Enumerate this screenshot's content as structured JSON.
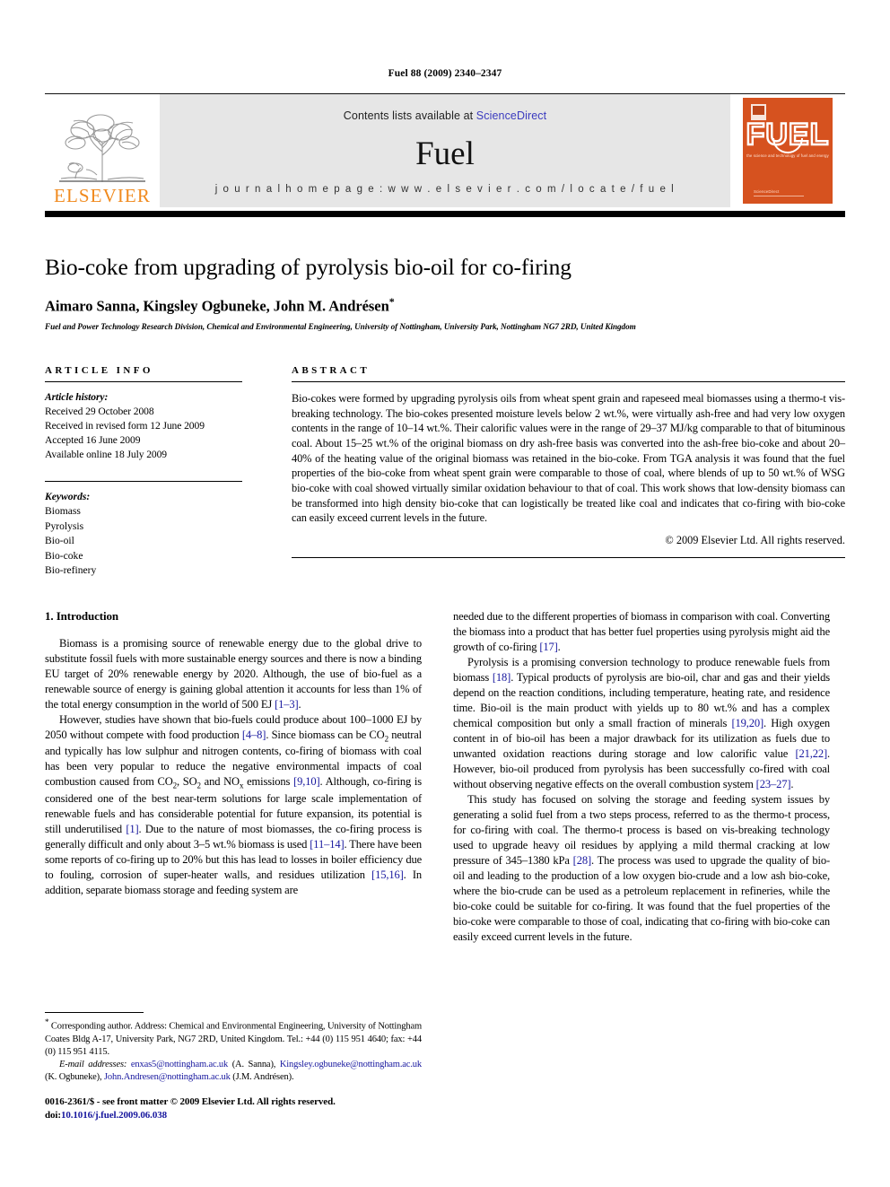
{
  "running_head": "Fuel 88 (2009) 2340–2347",
  "masthead": {
    "publisher_name": "ELSEVIER",
    "contents_prefix": "Contents lists available at ",
    "sciencedirect": "ScienceDirect",
    "journal_name": "Fuel",
    "homepage": "j o u r n a l   h o m e p a g e :   w w w . e l s e v i e r . c o m / l o c a t e / f u e l",
    "cover": {
      "title": "FUEL",
      "subtitle": "the science and technology of fuel and energy",
      "footer": "ScienceDirect"
    }
  },
  "article": {
    "title": "Bio-coke from upgrading of pyrolysis bio-oil for co-firing",
    "authors": "Aimaro Sanna, Kingsley Ogbuneke, John M. Andrésen",
    "author_star": "*",
    "affiliation": "Fuel and Power Technology Research Division, Chemical and Environmental Engineering, University of Nottingham, University Park, Nottingham NG7 2RD, United Kingdom"
  },
  "article_info": {
    "heading": "ARTICLE INFO",
    "history_label": "Article history:",
    "history": [
      "Received 29 October 2008",
      "Received in revised form 12 June 2009",
      "Accepted 16 June 2009",
      "Available online 18 July 2009"
    ],
    "keywords_label": "Keywords:",
    "keywords": [
      "Biomass",
      "Pyrolysis",
      "Bio-oil",
      "Bio-coke",
      "Bio-refinery"
    ]
  },
  "abstract": {
    "heading": "ABSTRACT",
    "text": "Bio-cokes were formed by upgrading pyrolysis oils from wheat spent grain and rapeseed meal biomasses using a thermo-t vis-breaking technology. The bio-cokes presented moisture levels below 2 wt.%, were virtually ash-free and had very low oxygen contents in the range of 10–14 wt.%. Their calorific values were in the range of 29–37 MJ/kg comparable to that of bituminous coal. About 15–25 wt.% of the original biomass on dry ash-free basis was converted into the ash-free bio-coke and about 20–40% of the heating value of the original biomass was retained in the bio-coke. From TGA analysis it was found that the fuel properties of the bio-coke from wheat spent grain were comparable to those of coal, where blends of up to 50 wt.% of WSG bio-coke with coal showed virtually similar oxidation behaviour to that of coal. This work shows that low-density biomass can be transformed into high density bio-coke that can logistically be treated like coal and indicates that co-firing with bio-coke can easily exceed current levels in the future.",
    "copyright": "© 2009 Elsevier Ltd. All rights reserved."
  },
  "introduction": {
    "section_title": "1. Introduction",
    "left_paragraphs": [
      "Biomass is a promising source of renewable energy due to the global drive to substitute fossil fuels with more sustainable energy sources and there is now a binding EU target of 20% renewable energy by 2020. Although, the use of bio-fuel as a renewable source of energy is gaining global attention it accounts for less than 1% of the total energy consumption in the world of 500 EJ [1–3].",
      "However, studies have shown that bio-fuels could produce about 100–1000 EJ by 2050 without compete with food production [4–8]. Since biomass can be CO2 neutral and typically has low sulphur and nitrogen contents, co-firing of biomass with coal has been very popular to reduce the negative environmental impacts of coal combustion caused from CO2, SO2 and NOx emissions [9,10]. Although, co-firing is considered one of the best near-term solutions for large scale implementation of renewable fuels and has considerable potential for future expansion, its potential is still underutilised [1]. Due to the nature of most biomasses, the co-firing process is generally difficult and only about 3–5 wt.% biomass is used [11–14]. There have been some reports of co-firing up to 20% but this has lead to losses in boiler efficiency due to fouling, corrosion of super-heater walls, and residues utilization [15,16]. In addition, separate biomass storage and feeding system are"
    ],
    "right_paragraphs": [
      "needed due to the different properties of biomass in comparison with coal. Converting the biomass into a product that has better fuel properties using pyrolysis might aid the growth of co-firing [17].",
      "Pyrolysis is a promising conversion technology to produce renewable fuels from biomass [18]. Typical products of pyrolysis are bio-oil, char and gas and their yields depend on the reaction conditions, including temperature, heating rate, and residence time. Bio-oil is the main product with yields up to 80 wt.% and has a complex chemical composition but only a small fraction of minerals [19,20]. High oxygen content in of bio-oil has been a major drawback for its utilization as fuels due to unwanted oxidation reactions during storage and low calorific value [21,22]. However, bio-oil produced from pyrolysis has been successfully co-fired with coal without observing negative effects on the overall combustion system [23–27].",
      "This study has focused on solving the storage and feeding system issues by generating a solid fuel from a two steps process, referred to as the thermo-t process, for co-firing with coal. The thermo-t process is based on vis-breaking technology used to upgrade heavy oil residues by applying a mild thermal cracking at low pressure of 345–1380 kPa [28]. The process was used to upgrade the quality of bio-oil and leading to the production of a low oxygen bio-crude and a low ash bio-coke, where the bio-crude can be used as a petroleum replacement in refineries, while the bio-coke could be suitable for co-firing. It was found that the fuel properties of the bio-coke were comparable to those of coal, indicating that co-firing with bio-coke can easily exceed current levels in the future."
    ]
  },
  "footnote": {
    "star": "*",
    "corresponding": " Corresponding author. Address: Chemical and Environmental Engineering, University of Nottingham Coates Bldg A-17, University Park, NG7 2RD, United Kingdom. Tel.: +44 (0) 115 951 4640; fax: +44 (0) 115 951 4115.",
    "email_label": "E-mail addresses:",
    "email1": "enxas5@nottingham.ac.uk",
    "email1_name": " (A. Sanna), ",
    "email2": "Kingsley.ogbuneke@nottingham.ac.uk",
    "email2_name": " (K. Ogbuneke), ",
    "email3": "John.Andresen@nottingham.ac.uk",
    "email3_name": " (J.M. Andrésen)."
  },
  "imprint": {
    "front_matter": "0016-2361/$ - see front matter © 2009 Elsevier Ltd. All rights reserved.",
    "doi_label": "doi:",
    "doi": "10.1016/j.fuel.2009.06.038"
  }
}
